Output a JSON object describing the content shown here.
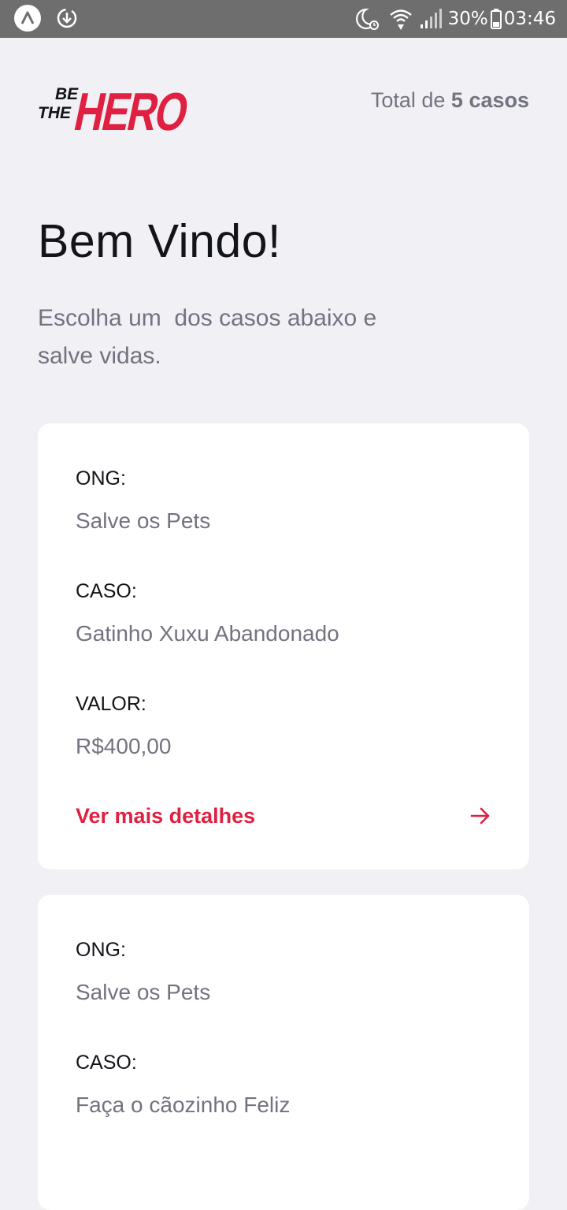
{
  "status_bar": {
    "battery": "30%",
    "time": "03:46",
    "icons": [
      "app-icon",
      "download-icon",
      "moon-alarm-icon",
      "wifi-icon",
      "signal-icon",
      "battery-icon"
    ]
  },
  "header": {
    "logo_line1": "BE",
    "logo_line2": "THE",
    "logo_word": "HERO",
    "total_prefix": "Total de",
    "total_value": "5 casos"
  },
  "intro": {
    "title": "Bem Vindo!",
    "description": "Escolha um  dos casos abaixo e\nsalve vidas."
  },
  "incidents": [
    {
      "ong_label": "ONG:",
      "ong": "Salve os Pets",
      "case_label": "CASO:",
      "case": "Gatinho Xuxu Abandonado",
      "value_label": "VALOR:",
      "value": "R$400,00",
      "details_label": "Ver mais detalhes"
    },
    {
      "ong_label": "ONG:",
      "ong": "Salve os Pets",
      "case_label": "CASO:",
      "case": "Faça o cãozinho Feliz"
    }
  ],
  "colors": {
    "background": "#f0f0f5",
    "brand": "#e02041",
    "title": "#13131a",
    "text": "#737380",
    "status_bar": "#6e6e6e"
  }
}
